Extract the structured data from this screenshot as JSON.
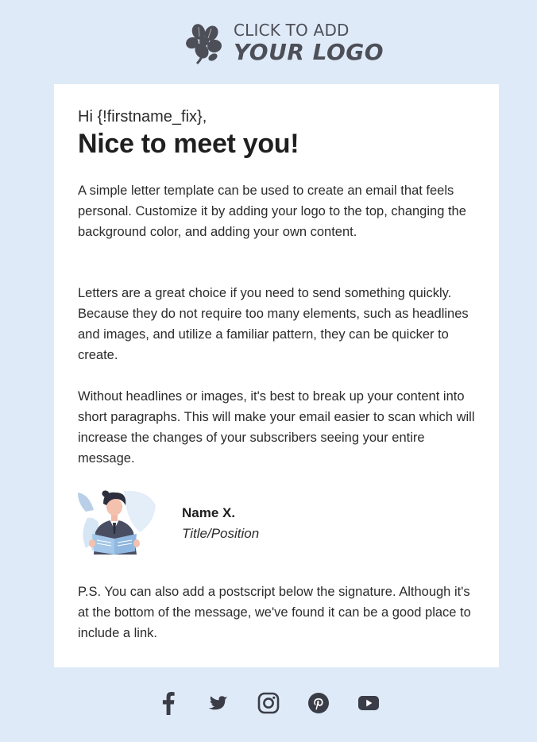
{
  "header": {
    "logo_line1": "CLICK TO ADD",
    "logo_line2": "YOUR LOGO",
    "logo_icon": "clover-flower-icon"
  },
  "letter": {
    "greeting": "Hi {!firstname_fix},",
    "headline": "Nice to meet you!",
    "paragraphs": [
      "A simple letter template can be used to create an email that feels personal. Customize it by adding your logo to the top, changing the background color, and adding your own content.",
      "Letters are a great choice if you need to send something quickly. Because they do not require too many elements, such as headlines and images, and utilize a familiar pattern, they can be quicker to create.",
      "Without headlines or images, it's best to break up your content into short paragraphs. This will make your email easier to scan which will increase the changes of your subscribers seeing your entire message."
    ],
    "postscript": "P.S. You can also add a postscript below the signature. Although it's at the bottom of the message, we've found it can be a good place to include a link."
  },
  "signature": {
    "name": "Name X.",
    "title": "Title/Position",
    "avatar": "person-reading-illustration"
  },
  "footer": {
    "social_icons": [
      "facebook-icon",
      "twitter-icon",
      "instagram-icon",
      "pinterest-icon",
      "youtube-icon"
    ]
  },
  "colors": {
    "background": "#dfeaf8",
    "card": "#ffffff",
    "text": "#2b2b2b",
    "logo": "#4d4f58",
    "social_icon": "#3a3d47"
  }
}
